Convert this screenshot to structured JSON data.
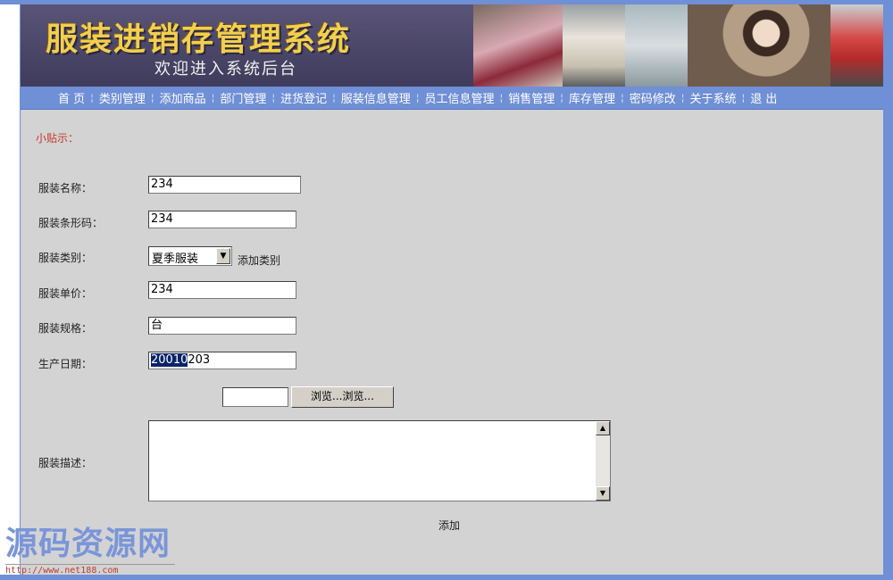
{
  "header": {
    "title": "服装进销存管理系统",
    "subtitle": "欢迎进入系统后台"
  },
  "nav": {
    "items": [
      "首 页",
      "类别管理",
      "添加商品",
      "部门管理",
      "进货登记",
      "服装信息管理",
      "员工信息管理",
      "销售管理",
      "库存管理",
      "密码修改",
      "关于系统",
      "退 出"
    ]
  },
  "tip": "小贴示：",
  "form": {
    "name_label": "服装名称：",
    "name_value": "234",
    "barcode_label": "服装条形码：",
    "barcode_value": "234",
    "category_label": "服装类别：",
    "category_value": "夏季服装",
    "add_category": "添加类别",
    "price_label": "服装单价：",
    "price_value": "234",
    "spec_label": "服装规格：",
    "spec_value": "台",
    "date_label": "生产日期：",
    "date_selected": "20010",
    "date_rest": "203",
    "browse_label": "浏览...浏览...",
    "desc_label": "服装描述：",
    "desc_value": "",
    "submit_label": "添加"
  },
  "watermark": {
    "text": "源码资源网",
    "url": "http://www.net188.com"
  }
}
